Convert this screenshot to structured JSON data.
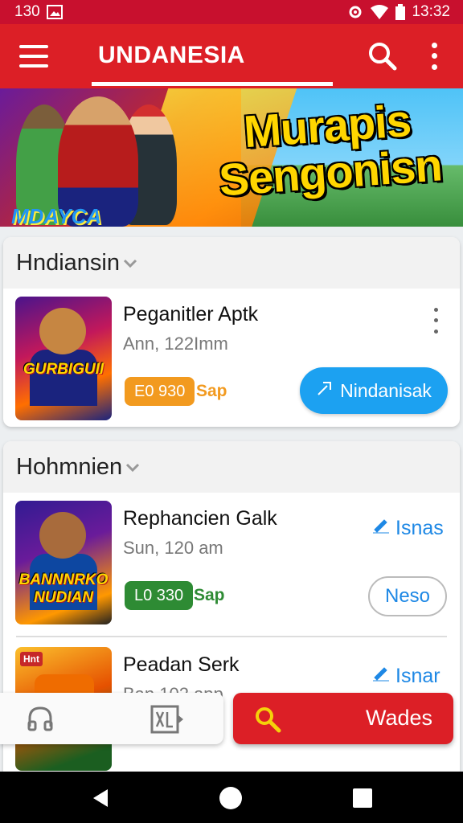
{
  "status_bar": {
    "left_text": "130",
    "time": "13:32"
  },
  "app_bar": {
    "title": "UNDANESIA"
  },
  "banner": {
    "title_line1": "Murapis",
    "title_line2": "Sengonisn",
    "subtitle": "MDAYCA"
  },
  "sections": [
    {
      "header": "Hndiansin",
      "items": [
        {
          "thumb_caption": "GURBIGUII",
          "title": "Peganitler Aptk",
          "subtitle": "Ann, 122Imm",
          "badge": "E0 930",
          "tag": "Sap",
          "action": "Nindanisak"
        }
      ]
    },
    {
      "header": "Hohmnien",
      "items": [
        {
          "thumb_caption_1": "BANNNRKO",
          "thumb_caption_2": "NUDIAN",
          "title": "Rephancien Galk",
          "subtitle": "Sun, 120 am",
          "badge": "L0 330",
          "tag": "Sap",
          "link_action": "Isnas",
          "button": "Neso"
        },
        {
          "thumb_caption": "Hnt",
          "title": "Peadan Serk",
          "subtitle": "Ban 102 app",
          "link_action": "Isnar"
        }
      ]
    }
  ],
  "fab": {
    "label": "Wades"
  },
  "colors": {
    "primary": "#dc1f26",
    "accent_blue": "#1ca1f1",
    "badge_orange": "#f29a1f",
    "badge_green": "#2e8b34"
  }
}
